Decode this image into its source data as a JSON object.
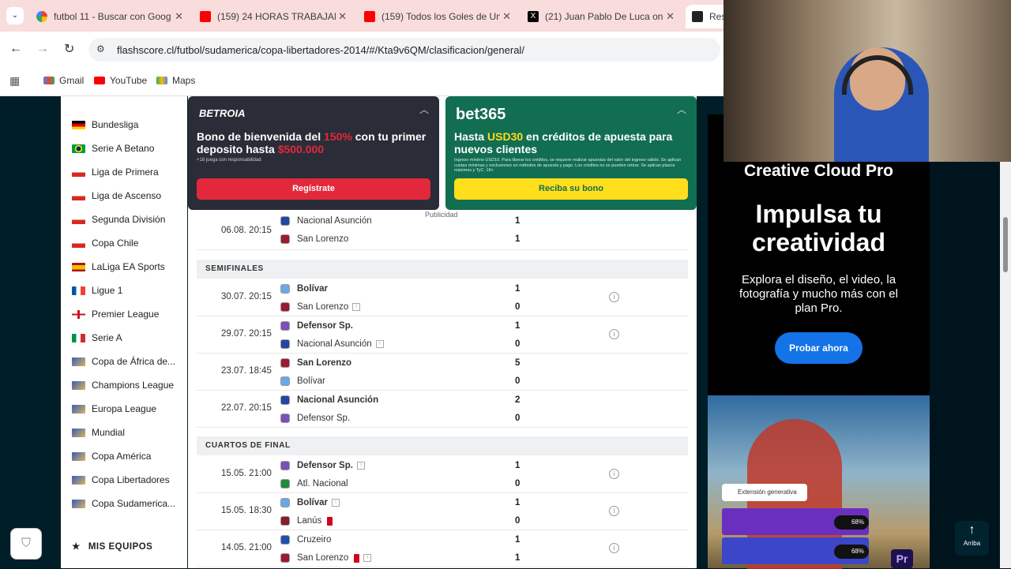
{
  "tabs": [
    {
      "title": "futbol 11 - Buscar con Goog",
      "icon": "google-icon"
    },
    {
      "title": "(159) 24 HORAS TRABAJANDO",
      "icon": "youtube-icon"
    },
    {
      "title": "(159) Todos los Goles de Un",
      "icon": "youtube-icon"
    },
    {
      "title": "(21) Juan Pablo De Luca on",
      "icon": "x-icon"
    },
    {
      "title": "Res",
      "icon": "flashscore-icon"
    }
  ],
  "address": "flashscore.cl/futbol/sudamerica/copa-libertadores-2014/#/Kta9v6QM/clasificacion/general/",
  "bookmarks": [
    "Gmail",
    "YouTube",
    "Maps"
  ],
  "sidebar": {
    "items": [
      {
        "label": "Bundesliga",
        "flag": "de"
      },
      {
        "label": "Serie A Betano",
        "flag": "br"
      },
      {
        "label": "Liga de Primera",
        "flag": "cl"
      },
      {
        "label": "Liga de Ascenso",
        "flag": "cl"
      },
      {
        "label": "Segunda División",
        "flag": "cl"
      },
      {
        "label": "Copa Chile",
        "flag": "cl"
      },
      {
        "label": "LaLiga EA Sports",
        "flag": "es"
      },
      {
        "label": "Ligue 1",
        "flag": "fr"
      },
      {
        "label": "Premier League",
        "flag": "en"
      },
      {
        "label": "Serie A",
        "flag": "it"
      },
      {
        "label": "Copa de África de...",
        "flag": "world"
      },
      {
        "label": "Champions League",
        "flag": "world"
      },
      {
        "label": "Europa League",
        "flag": "world"
      },
      {
        "label": "Mundial",
        "flag": "world"
      },
      {
        "label": "Copa América",
        "flag": "world"
      },
      {
        "label": "Copa Libertadores",
        "flag": "world"
      },
      {
        "label": "Copa Sudamerica...",
        "flag": "world"
      }
    ],
    "my_teams": "MIS EQUIPOS"
  },
  "ads": {
    "betroia": {
      "logo": "BETROIA",
      "headline1": "Bono de bienvenida del ",
      "pct": "150%",
      "headline2": " con tu primer deposito hasta ",
      "amount": "$500.000",
      "small": "+18 juega con responsabilidad",
      "button": "Regístrate"
    },
    "bet365": {
      "logo": "bet365",
      "headline1": "Hasta ",
      "amount": "USD30",
      "headline2": " en créditos de apuesta para nuevos clientes",
      "small": "Ingreso mínimo USD10. Para liberar los créditos, se requiere realizar apuestas del valor del ingreso válido. Se aplican cuotas mínimas y exclusiones en métodos de apuesta y pago. Los créditos no se pueden retirar. Se aplican plazos máximos y TyC. 18+",
      "button": "Reciba su bono"
    },
    "label": "Publicidad"
  },
  "results": {
    "top": {
      "time": "06.08. 20:15",
      "home": "Nacional Asunción",
      "away": "San Lorenzo",
      "hs": "1",
      "as": "1"
    },
    "semis_title": "SEMIFINALES",
    "semis": [
      {
        "time": "30.07. 20:15",
        "home": "Bolívar",
        "away": "San Lorenzo",
        "hs": "1",
        "as": "0"
      },
      {
        "time": "29.07. 20:15",
        "home": "Defensor Sp.",
        "away": "Nacional Asunción",
        "hs": "1",
        "as": "0"
      },
      {
        "time": "23.07. 18:45",
        "home": "San Lorenzo",
        "away": "Bolívar",
        "hs": "5",
        "as": "0"
      },
      {
        "time": "22.07. 20:15",
        "home": "Nacional Asunción",
        "away": "Defensor Sp.",
        "hs": "2",
        "as": "0"
      }
    ],
    "qf_title": "CUARTOS DE FINAL",
    "qf": [
      {
        "time": "15.05. 21:00",
        "home": "Defensor Sp.",
        "away": "Atl. Nacional",
        "hs": "1",
        "as": "0"
      },
      {
        "time": "15.05. 18:30",
        "home": "Bolívar",
        "away": "Lanús",
        "hs": "1",
        "as": "0"
      },
      {
        "time": "14.05. 21:00",
        "home": "Cruzeiro",
        "away": "San Lorenzo",
        "hs": "1",
        "as": "1"
      }
    ]
  },
  "right_ad": {
    "brand": "Creative Cloud Pro",
    "title": "Impulsa tu creatividad",
    "body": "Explora el diseño, el video, la fotografía y mucho más con el plan Pro.",
    "cta": "Probar ahora",
    "chip": "Extensión generativa",
    "pct1": "68%",
    "pct2": "68%",
    "app": "Pr"
  },
  "back_to_top": "Arriba"
}
